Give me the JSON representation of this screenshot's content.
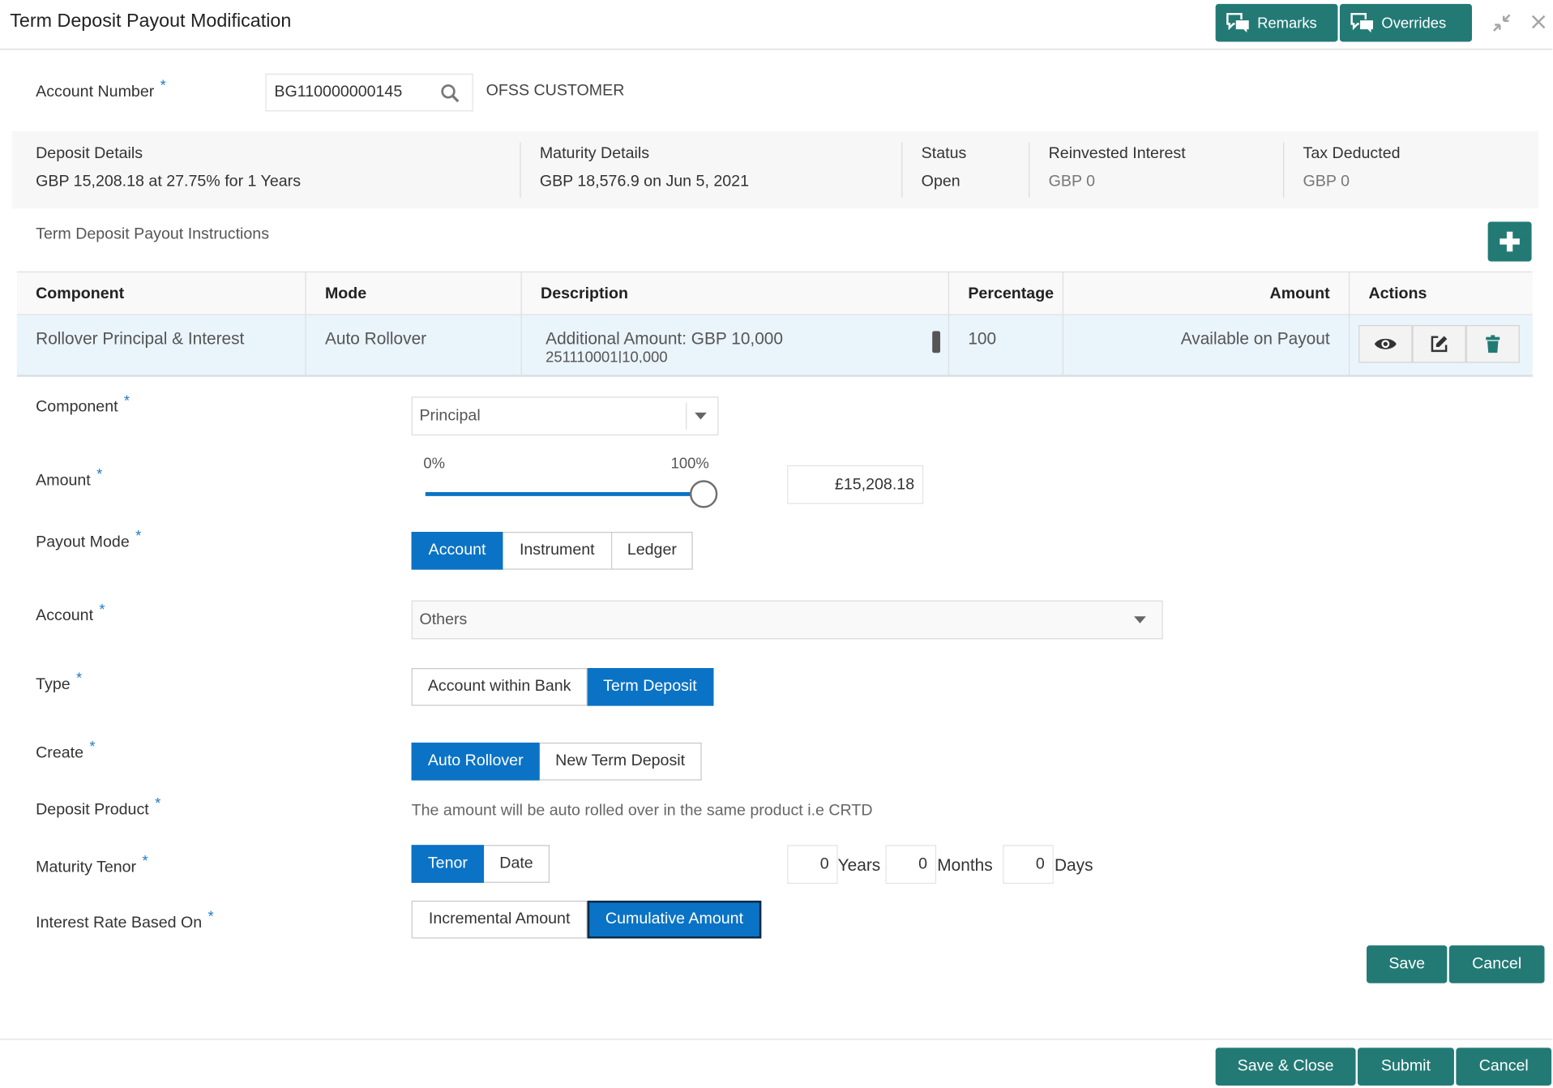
{
  "window": {
    "title": "Term Deposit Payout Modification",
    "remarks_label": "Remarks",
    "overrides_label": "Overrides"
  },
  "account": {
    "label": "Account Number",
    "value": "BG110000000145",
    "customer_name": "OFSS CUSTOMER"
  },
  "summary": {
    "deposit_details_label": "Deposit Details",
    "deposit_details_value": "GBP 15,208.18 at 27.75% for 1 Years",
    "maturity_details_label": "Maturity Details",
    "maturity_details_value": "GBP 18,576.9 on Jun 5, 2021",
    "status_label": "Status",
    "status_value": "Open",
    "reinvested_label": "Reinvested Interest",
    "reinvested_value": "GBP 0",
    "tax_label": "Tax Deducted",
    "tax_value": "GBP 0"
  },
  "instructions": {
    "section_title": "Term Deposit Payout Instructions",
    "columns": {
      "component": "Component",
      "mode": "Mode",
      "description": "Description",
      "percentage": "Percentage",
      "amount": "Amount",
      "actions": "Actions"
    },
    "rows": [
      {
        "component": "Rollover Principal & Interest",
        "mode": "Auto Rollover",
        "description_line1": "Additional Amount: GBP 10,000",
        "description_line2": "251110001|10,000",
        "percentage": "100",
        "amount": "Available on Payout"
      }
    ]
  },
  "form": {
    "component_label": "Component",
    "component_value": "Principal",
    "amount_label": "Amount",
    "slider_min_label": "0%",
    "slider_max_label": "100%",
    "slider_percent": 100,
    "amount_value": "£15,208.18",
    "payout_mode_label": "Payout Mode",
    "payout_mode_options": [
      "Account",
      "Instrument",
      "Ledger"
    ],
    "payout_mode_selected": "Account",
    "account_label": "Account",
    "account_value": "Others",
    "type_label": "Type",
    "type_options": [
      "Account within Bank",
      "Term Deposit"
    ],
    "type_selected": "Term Deposit",
    "create_label": "Create",
    "create_options": [
      "Auto Rollover",
      "New Term Deposit"
    ],
    "create_selected": "Auto Rollover",
    "deposit_product_label": "Deposit Product",
    "deposit_product_text": "The amount will be auto rolled over in the same product i.e CRTD",
    "maturity_tenor_label": "Maturity Tenor",
    "maturity_tenor_options": [
      "Tenor",
      "Date"
    ],
    "maturity_tenor_selected": "Tenor",
    "years_value": "0",
    "years_label": "Years",
    "months_value": "0",
    "months_label": "Months",
    "days_value": "0",
    "days_label": "Days",
    "interest_rate_label": "Interest Rate Based On",
    "interest_rate_options": [
      "Incremental Amount",
      "Cumulative Amount"
    ],
    "interest_rate_selected": "Cumulative Amount",
    "save_label": "Save",
    "cancel_label": "Cancel"
  },
  "footer": {
    "save_close_label": "Save & Close",
    "submit_label": "Submit",
    "cancel_label": "Cancel"
  },
  "colors": {
    "accent_teal": "#237a75",
    "selected_blue": "#0a73c5",
    "required_star": "#1e7bc6"
  }
}
